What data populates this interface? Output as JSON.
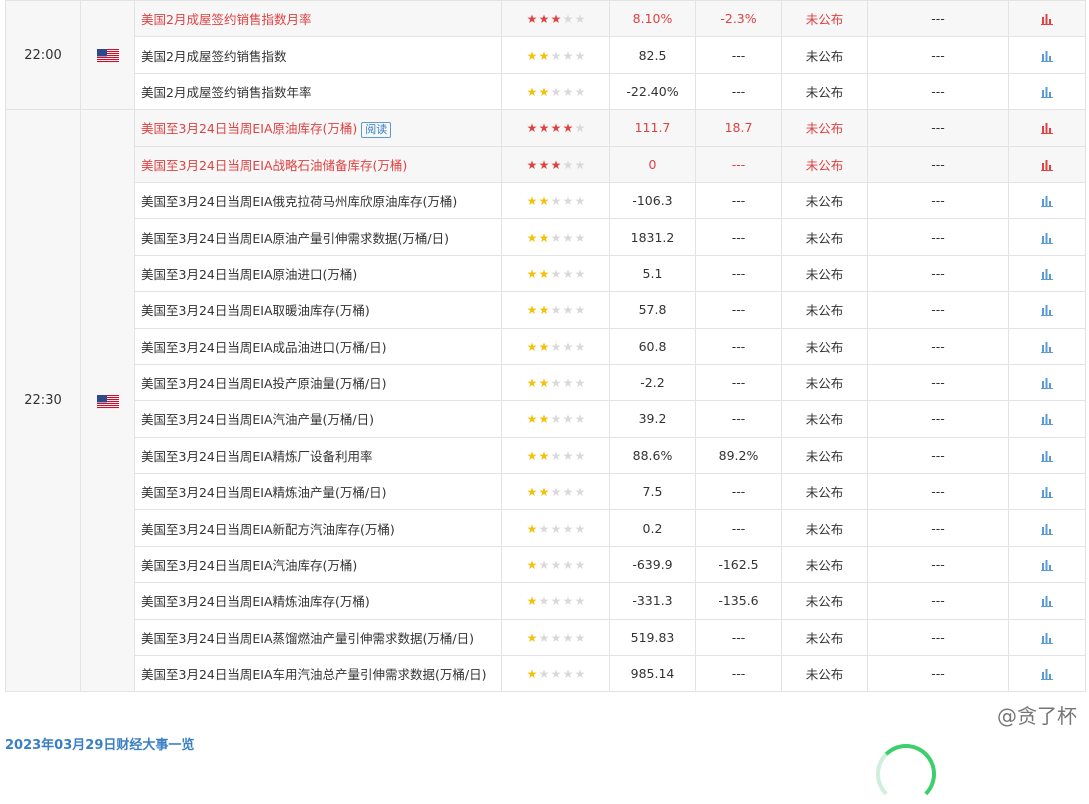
{
  "groups": [
    {
      "time": "22:00",
      "flag": "us-flag-icon",
      "rows": [
        {
          "name": "美国2月成屋签约销售指数月率",
          "stars": 3,
          "previous": "8.10%",
          "forecast": "-2.3%",
          "actual": "未公布",
          "impact": "---",
          "highlight": true
        },
        {
          "name": "美国2月成屋签约销售指数",
          "stars": 2,
          "previous": "82.5",
          "forecast": "---",
          "actual": "未公布",
          "impact": "---",
          "highlight": false
        },
        {
          "name": "美国2月成屋签约销售指数年率",
          "stars": 2,
          "previous": "-22.40%",
          "forecast": "---",
          "actual": "未公布",
          "impact": "---",
          "highlight": false
        }
      ]
    },
    {
      "time": "22:30",
      "flag": "us-flag-icon",
      "rows": [
        {
          "name": "美国至3月24日当周EIA原油库存(万桶)",
          "tag": "阅读",
          "stars": 4,
          "previous": "111.7",
          "forecast": "18.7",
          "actual": "未公布",
          "impact": "---",
          "highlight": true
        },
        {
          "name": "美国至3月24日当周EIA战略石油储备库存(万桶)",
          "stars": 3,
          "previous": "0",
          "forecast": "---",
          "actual": "未公布",
          "impact": "---",
          "highlight": true
        },
        {
          "name": "美国至3月24日当周EIA俄克拉荷马州库欣原油库存(万桶)",
          "stars": 2,
          "previous": "-106.3",
          "forecast": "---",
          "actual": "未公布",
          "impact": "---",
          "highlight": false
        },
        {
          "name": "美国至3月24日当周EIA原油产量引伸需求数据(万桶/日)",
          "stars": 2,
          "previous": "1831.2",
          "forecast": "---",
          "actual": "未公布",
          "impact": "---",
          "highlight": false
        },
        {
          "name": "美国至3月24日当周EIA原油进口(万桶)",
          "stars": 2,
          "previous": "5.1",
          "forecast": "---",
          "actual": "未公布",
          "impact": "---",
          "highlight": false
        },
        {
          "name": "美国至3月24日当周EIA取暖油库存(万桶)",
          "stars": 2,
          "previous": "57.8",
          "forecast": "---",
          "actual": "未公布",
          "impact": "---",
          "highlight": false
        },
        {
          "name": "美国至3月24日当周EIA成品油进口(万桶/日)",
          "stars": 2,
          "previous": "60.8",
          "forecast": "---",
          "actual": "未公布",
          "impact": "---",
          "highlight": false
        },
        {
          "name": "美国至3月24日当周EIA投产原油量(万桶/日)",
          "stars": 2,
          "previous": "-2.2",
          "forecast": "---",
          "actual": "未公布",
          "impact": "---",
          "highlight": false
        },
        {
          "name": "美国至3月24日当周EIA汽油产量(万桶/日)",
          "stars": 2,
          "previous": "39.2",
          "forecast": "---",
          "actual": "未公布",
          "impact": "---",
          "highlight": false
        },
        {
          "name": "美国至3月24日当周EIA精炼厂设备利用率",
          "stars": 2,
          "previous": "88.6%",
          "forecast": "89.2%",
          "actual": "未公布",
          "impact": "---",
          "highlight": false
        },
        {
          "name": "美国至3月24日当周EIA精炼油产量(万桶/日)",
          "stars": 2,
          "previous": "7.5",
          "forecast": "---",
          "actual": "未公布",
          "impact": "---",
          "highlight": false
        },
        {
          "name": "美国至3月24日当周EIA新配方汽油库存(万桶)",
          "stars": 1,
          "previous": "0.2",
          "forecast": "---",
          "actual": "未公布",
          "impact": "---",
          "highlight": false
        },
        {
          "name": "美国至3月24日当周EIA汽油库存(万桶)",
          "stars": 1,
          "previous": "-639.9",
          "forecast": "-162.5",
          "actual": "未公布",
          "impact": "---",
          "highlight": false
        },
        {
          "name": "美国至3月24日当周EIA精炼油库存(万桶)",
          "stars": 1,
          "previous": "-331.3",
          "forecast": "-135.6",
          "actual": "未公布",
          "impact": "---",
          "highlight": false
        },
        {
          "name": "美国至3月24日当周EIA蒸馏燃油产量引伸需求数据(万桶/日)",
          "stars": 1,
          "previous": "519.83",
          "forecast": "---",
          "actual": "未公布",
          "impact": "---",
          "highlight": false
        },
        {
          "name": "美国至3月24日当周EIA车用汽油总产量引伸需求数据(万桶/日)",
          "stars": 1,
          "previous": "985.14",
          "forecast": "---",
          "actual": "未公布",
          "impact": "---",
          "highlight": false
        }
      ]
    }
  ],
  "max_stars": 5,
  "colors": {
    "star_normal": "#f4c10a",
    "star_high": "#e04141",
    "star_off": "#d9d9d9",
    "highlight_text": "#e04141",
    "link": "#3a7fc4"
  },
  "footer": {
    "link": "2023年03月29日财经大事一览"
  },
  "watermark": {
    "text": "@贪了杯"
  }
}
